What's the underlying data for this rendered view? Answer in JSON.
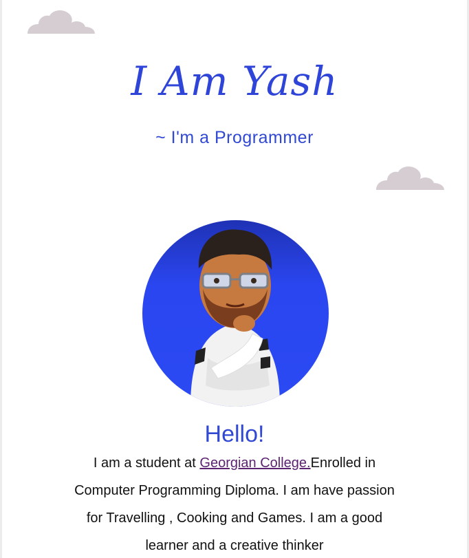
{
  "header": {
    "title": "I Am Yash",
    "subtitle": "~ I'm a Programmer"
  },
  "profile": {
    "avatar_icon": "avatar-character-icon",
    "greeting": "Hello!"
  },
  "bio": {
    "text_before": "I am a student at ",
    "link_text": "Georgian College.",
    "text_after": "Enrolled in Computer Programming Diploma. I am have passion for Travelling , Cooking and Games. I am a good learner and a creative thinker"
  },
  "colors": {
    "accent": "#3148d2",
    "cloud": "#d6cdd3",
    "link": "#5b2370",
    "text": "#111111"
  }
}
